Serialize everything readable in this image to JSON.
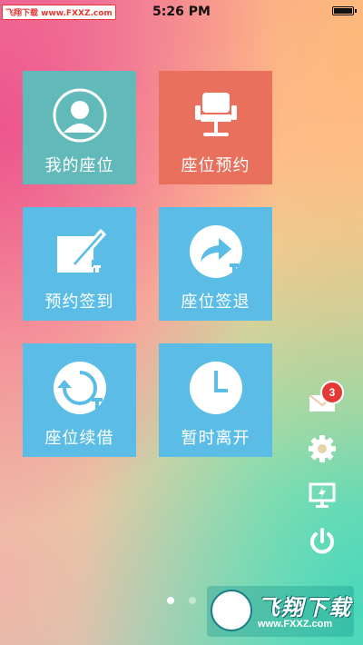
{
  "status_bar": {
    "watermark": "飞翔下载 www.FXXZ.com",
    "time": "5:26 PM"
  },
  "tiles": [
    {
      "label": "我的座位",
      "icon": "user-avatar-icon",
      "color": "#62b9b9"
    },
    {
      "label": "座位预约",
      "icon": "chair-icon",
      "color": "#e8705c"
    },
    {
      "label": "预约签到",
      "icon": "checkin-pen-icon",
      "color": "#5bbde6"
    },
    {
      "label": "座位签退",
      "icon": "checkout-arrow-icon",
      "color": "#5bbde6"
    },
    {
      "label": "座位续借",
      "icon": "renew-cycle-icon",
      "color": "#5bbde6"
    },
    {
      "label": "暂时离开",
      "icon": "clock-icon",
      "color": "#5bbde6"
    }
  ],
  "side_menu": {
    "message_badge": "3",
    "items": [
      "mail-icon",
      "gear-icon",
      "monitor-icon",
      "power-icon"
    ]
  },
  "pager": {
    "pages": 2,
    "active": 1
  },
  "watermark_logo": {
    "title": "飞翔下载",
    "url": "www.FXXZ.com"
  }
}
